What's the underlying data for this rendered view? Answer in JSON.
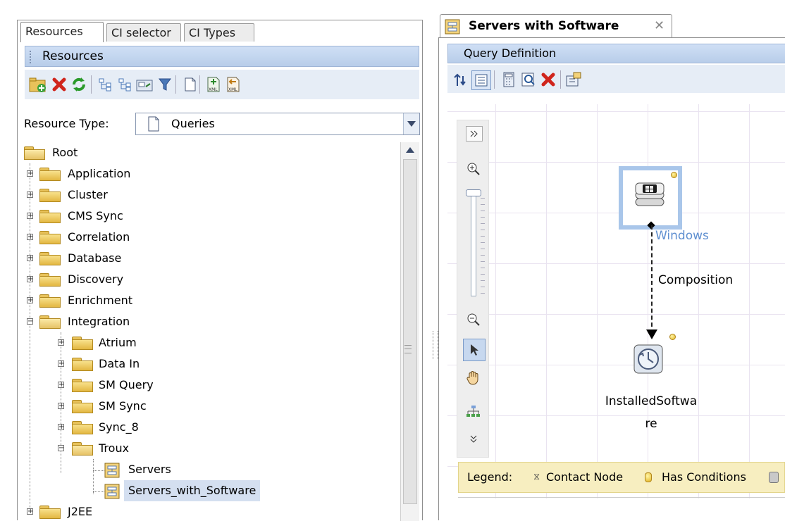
{
  "left_tabs": [
    "Resources",
    "CI selector",
    "CI Types"
  ],
  "resources_header": "Resources",
  "left_toolbar_icons": [
    "new-folder-icon",
    "delete-icon",
    "refresh-icon",
    "expand-icon",
    "collapse-icon",
    "copy-to-folder-icon",
    "filter-icon",
    "new-resource-icon",
    "export-xml-icon",
    "import-xml-icon"
  ],
  "resource_type": {
    "label": "Resource Type:",
    "value": "Queries"
  },
  "tree": {
    "root": "Root",
    "folders": [
      "Application",
      "Cluster",
      "CMS Sync",
      "Correlation",
      "Database",
      "Discovery",
      "Enrichment",
      "Integration"
    ],
    "integration_children": [
      "Atrium",
      "Data In",
      "SM Query",
      "SM Sync",
      "Sync_8",
      "Troux"
    ],
    "troux_children": [
      "Servers",
      "Servers_with_Software"
    ],
    "after": [
      "J2EE"
    ],
    "selected": "Servers_with_Software"
  },
  "right_tab": {
    "title": "Servers with Software"
  },
  "query_definition_header": "Query Definition",
  "right_toolbar_icons": [
    "sort-icon",
    "properties-icon",
    "calculator-icon",
    "preview-icon",
    "delete-icon",
    "settings-icon"
  ],
  "nodes": {
    "source": "Windows",
    "target": "InstalledSoftwa re",
    "target_line1": "InstalledSoftwa",
    "target_line2": "re"
  },
  "edge_label": "Composition",
  "legend": {
    "label": "Legend:",
    "contact_node": "Contact Node",
    "has_conditions": "Has Conditions"
  },
  "colors": {
    "header_blue": "#b8cde9",
    "selection": "#d4dff0",
    "legend_bg": "#f7eec0",
    "node_frame": "#a9c6ea",
    "windows_label": "#5f8fd0"
  }
}
